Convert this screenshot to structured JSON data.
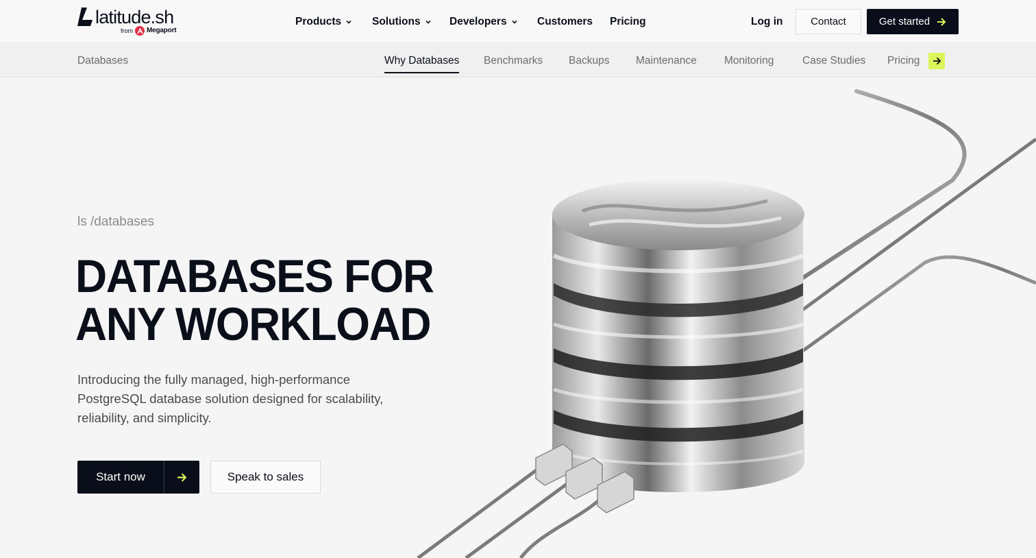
{
  "header": {
    "logo_text": "latitude.sh",
    "logo_from": "from",
    "logo_partner": "Megaport",
    "menu": [
      {
        "label": "Products",
        "has_dropdown": true
      },
      {
        "label": "Solutions",
        "has_dropdown": true
      },
      {
        "label": "Developers",
        "has_dropdown": true
      },
      {
        "label": "Customers",
        "has_dropdown": false
      },
      {
        "label": "Pricing",
        "has_dropdown": false
      }
    ],
    "login_label": "Log in",
    "contact_label": "Contact",
    "get_started_label": "Get started"
  },
  "subnav": {
    "section_title": "Databases",
    "tabs": [
      {
        "label": "Why Databases",
        "active": true
      },
      {
        "label": "Benchmarks",
        "active": false
      },
      {
        "label": "Backups",
        "active": false
      },
      {
        "label": "Maintenance",
        "active": false
      },
      {
        "label": "Monitoring",
        "active": false
      },
      {
        "label": "Case Studies",
        "active": false
      },
      {
        "label": "Pricing",
        "active": false
      }
    ]
  },
  "hero": {
    "eyebrow": "ls /databases",
    "headline_line1": "DATABASES FOR",
    "headline_line2": "ANY WORKLOAD",
    "lead": "Introducing the fully managed, high-performance PostgreSQL database solution designed for scalability, reliability, and simplicity.",
    "primary_cta": "Start now",
    "secondary_cta": "Speak to sales"
  },
  "colors": {
    "text_dark": "#0b0f1a",
    "muted": "#6c6c6c",
    "accent_lime": "#dcf55a",
    "brand_red": "#e12d45",
    "page_bg": "#f5f5f5"
  },
  "icons": {
    "logo_mark": "latitude-mark-icon",
    "dropdown": "chevron-down-icon",
    "arrow": "arrow-right-icon",
    "hero_art": "database-stack-illustration"
  }
}
